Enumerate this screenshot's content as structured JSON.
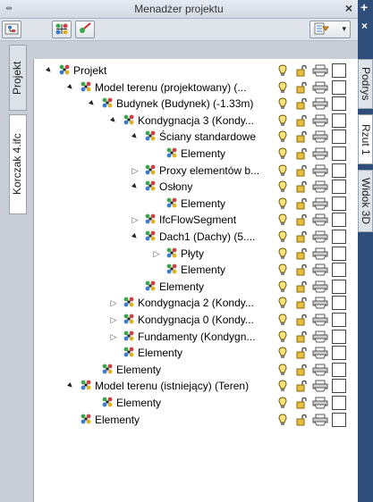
{
  "window": {
    "title": "Menadżer projektu",
    "close_glyph": "×",
    "pin_glyph": "⇹"
  },
  "toolbar": {
    "dropdown_arrow": "▾"
  },
  "left_tabs": [
    "Projekt",
    "Korczak 4.ifc"
  ],
  "right_tabs": [
    "Podrys",
    "Rzut 1",
    "Widok 3D"
  ],
  "right_strip": {
    "plus": "+",
    "close": "×"
  },
  "tree": {
    "rows": [
      {
        "label": "Projekt",
        "level": 0,
        "exp": "▲",
        "checked": false
      },
      {
        "label": "Model terenu  (projektowany) (...",
        "level": 1,
        "exp": "▲",
        "checked": false
      },
      {
        "label": "Budynek (Budynek) (-1.33m)",
        "level": 2,
        "exp": "▲",
        "checked": false
      },
      {
        "label": "Kondygnacja 3 (Kondy...",
        "level": 3,
        "exp": "▲",
        "checked": false
      },
      {
        "label": "Ściany standardowe",
        "level": 4,
        "exp": "▲",
        "checked": false
      },
      {
        "label": "Elementy",
        "level": 5,
        "exp": "",
        "checked": false
      },
      {
        "label": "Proxy elementów b...",
        "level": 4,
        "exp": "▷",
        "checked": false
      },
      {
        "label": "Osłony",
        "level": 4,
        "exp": "▲",
        "checked": false
      },
      {
        "label": "Elementy",
        "level": 5,
        "exp": "",
        "checked": false
      },
      {
        "label": "IfcFlowSegment",
        "level": 4,
        "exp": "▷",
        "checked": false
      },
      {
        "label": "Dach1 (Dachy) (5....",
        "level": 4,
        "exp": "▲",
        "checked": false
      },
      {
        "label": "Płyty",
        "level": 5,
        "exp": "▷",
        "checked": false
      },
      {
        "label": "Elementy",
        "level": 5,
        "exp": "",
        "checked": false
      },
      {
        "label": "Elementy",
        "level": 4,
        "exp": "",
        "checked": false
      },
      {
        "label": "Kondygnacja 2 (Kondy...",
        "level": 3,
        "exp": "▷",
        "checked": false
      },
      {
        "label": "Kondygnacja 0 (Kondy...",
        "level": 3,
        "exp": "▷",
        "checked": false
      },
      {
        "label": "Fundamenty (Kondygn...",
        "level": 3,
        "exp": "▷",
        "checked": false
      },
      {
        "label": "Elementy",
        "level": 3,
        "exp": "",
        "checked": false
      },
      {
        "label": "Elementy",
        "level": 2,
        "exp": "",
        "checked": false
      },
      {
        "label": "Model terenu  (istniejący) (Teren)",
        "level": 1,
        "exp": "▲",
        "checked": false
      },
      {
        "label": "Elementy",
        "level": 2,
        "exp": "",
        "checked": false
      },
      {
        "label": "Elementy",
        "level": 1,
        "exp": "",
        "checked": false
      }
    ]
  },
  "icons": {
    "node": "project-node-icon",
    "visibility": "lightbulb-icon",
    "lock": "unlocked-padlock-icon",
    "print": "printer-icon"
  },
  "colors": {
    "accent_dark": "#2f4e79",
    "panel_bg": "#c9ced6"
  }
}
